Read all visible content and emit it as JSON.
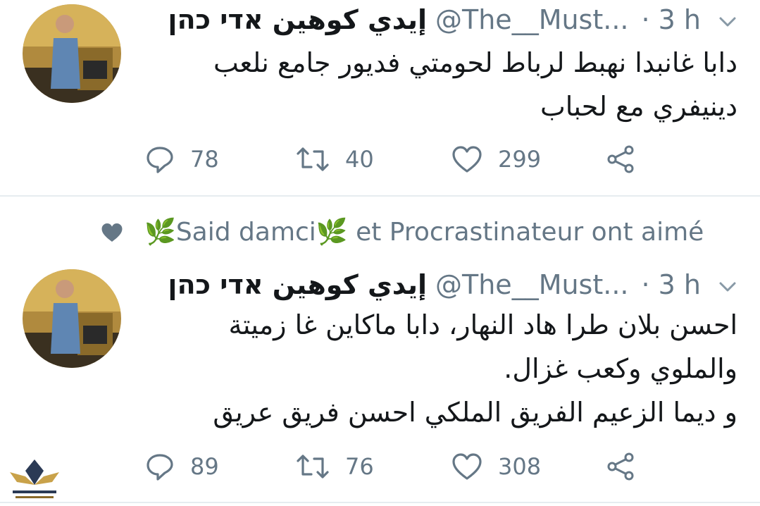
{
  "tweets": [
    {
      "display_name": "إيدي كوهين אדי כהן",
      "handle": "@The__Must...",
      "time": "· 3 h",
      "text": "دابا غانبدا نهبط لرباط لحومتي فديور جامع  نلعب\nدينيفري مع لحباب",
      "replies": "78",
      "retweets": "40",
      "likes": "299"
    },
    {
      "display_name": "إيدي كوهين אדי כהן",
      "handle": "@The__Must...",
      "time": "· 3 h",
      "text": "احسن بلان طرا هاد النهار، دابا ماكاين غا زميتة\nوالملوي وكعب غزال.\nو ديما  الزعيم  الفريق الملكي احسن فريق عريق",
      "replies": "89",
      "retweets": "76",
      "likes": "308"
    }
  ],
  "social_context": {
    "text": "🌿Said damci🌿 et Procrastinateur ont aimé"
  },
  "icons": {
    "reply": "reply-icon",
    "retweet": "retweet-icon",
    "like": "heart-icon",
    "share": "share-icon",
    "more": "chevron-down-icon",
    "liked": "small-heart-icon"
  },
  "colors": {
    "text": "#14171a",
    "secondary": "#657786",
    "divider": "#e6ecf0"
  }
}
